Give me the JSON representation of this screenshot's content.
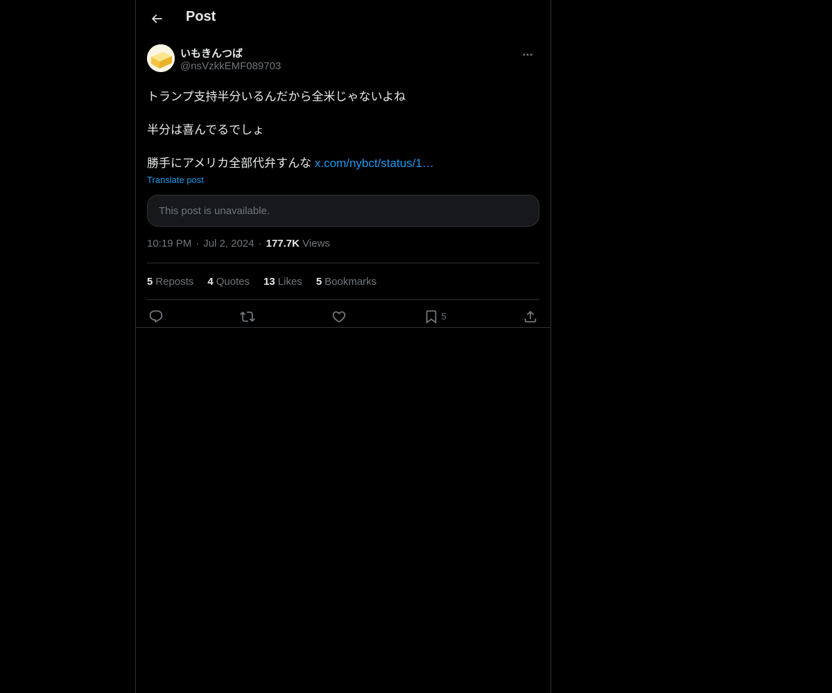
{
  "header": {
    "title": "Post",
    "back_icon": "arrow-left-icon"
  },
  "post": {
    "author": {
      "display_name": "いもきんつば",
      "handle": "@nsVzkkEMF089703",
      "avatar_icon": "butter-avatar"
    },
    "text_lines": [
      "トランプ支持半分いるんだから全米じゃないよね",
      "半分は喜んでるでしょ",
      "勝手にアメリカ全部代弁すんな"
    ],
    "link_text": "x.com/nybct/status/1…",
    "translate_label": "Translate post",
    "quote_unavailable": "This post is unavailable.",
    "time": "10:19 PM",
    "date": "Jul 2, 2024",
    "views_count": "177.7K",
    "views_label": "Views",
    "separator": "·"
  },
  "stats": {
    "reposts": {
      "count": "5",
      "label": "Reposts"
    },
    "quotes": {
      "count": "4",
      "label": "Quotes"
    },
    "likes": {
      "count": "13",
      "label": "Likes"
    },
    "bookmarks": {
      "count": "5",
      "label": "Bookmarks"
    }
  },
  "actions": {
    "reply_icon": "reply-icon",
    "repost_icon": "repost-icon",
    "like_icon": "heart-icon",
    "bookmark_icon": "bookmark-icon",
    "bookmark_count": "5",
    "share_icon": "share-icon"
  },
  "colors": {
    "background": "#000000",
    "text": "#e7e9ea",
    "secondary": "#71767b",
    "accent": "#1d9bf0",
    "border": "#2f3336"
  }
}
